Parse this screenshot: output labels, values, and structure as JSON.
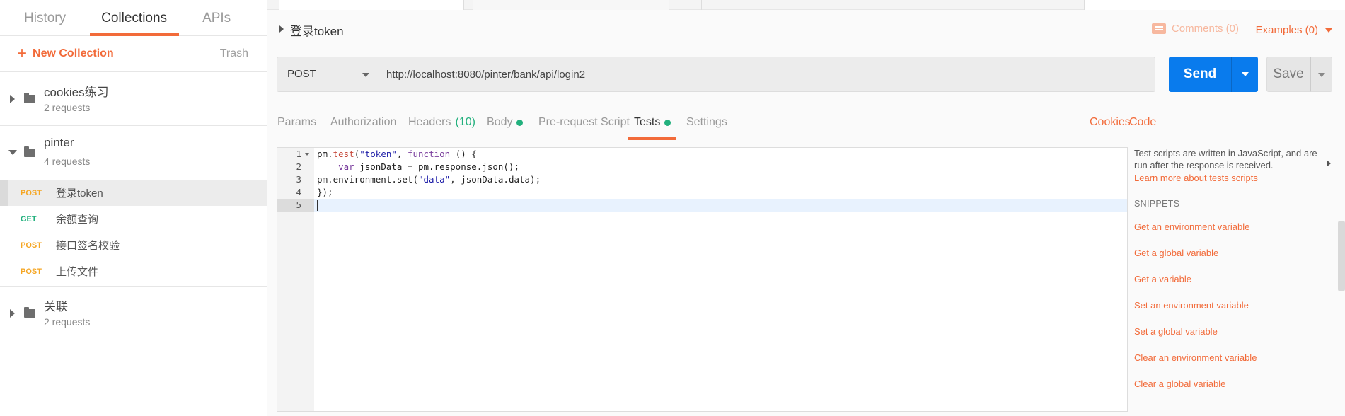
{
  "sidebar": {
    "tabs": [
      {
        "label": "History"
      },
      {
        "label": "Collections"
      },
      {
        "label": "APIs"
      }
    ],
    "new_collection_label": "New Collection",
    "trash_label": "Trash",
    "collections": [
      {
        "name": "cookies练习",
        "count": "2 requests"
      },
      {
        "name": "pinter",
        "count": "4 requests",
        "requests": [
          {
            "method": "POST",
            "name": "登录token"
          },
          {
            "method": "GET",
            "name": "余额查询"
          },
          {
            "method": "POST",
            "name": "接口签名校验"
          },
          {
            "method": "POST",
            "name": "上传文件"
          }
        ]
      },
      {
        "name": "关联",
        "count": "2 requests"
      }
    ]
  },
  "request": {
    "title": "登录token",
    "comments_label": "Comments (0)",
    "examples_label": "Examples (0)",
    "method": "POST",
    "url": "http://localhost:8080/pinter/bank/api/login2",
    "send_label": "Send",
    "save_label": "Save"
  },
  "tabs": {
    "params": "Params",
    "authorization": "Authorization",
    "headers": "Headers",
    "headers_count": "(10)",
    "body": "Body",
    "prerequest": "Pre-request Script",
    "tests": "Tests",
    "settings": "Settings",
    "cookies": "Cookies",
    "code": "Code"
  },
  "editor": {
    "line_numbers": [
      "1",
      "2",
      "3",
      "4",
      "5"
    ]
  },
  "side_panel": {
    "description": "Test scripts are written in JavaScript, and are run after the response is received.",
    "learn_more": "Learn more about tests scripts",
    "snippets_heading": "SNIPPETS",
    "snippets": [
      "Get an environment variable",
      "Get a global variable",
      "Get a variable",
      "Set an environment variable",
      "Set a global variable",
      "Clear an environment variable",
      "Clear a global variable"
    ]
  },
  "colors": {
    "accent": "#f26b3a",
    "send_blue": "#097bed",
    "post": "#f5a623",
    "get": "#22b07d"
  }
}
